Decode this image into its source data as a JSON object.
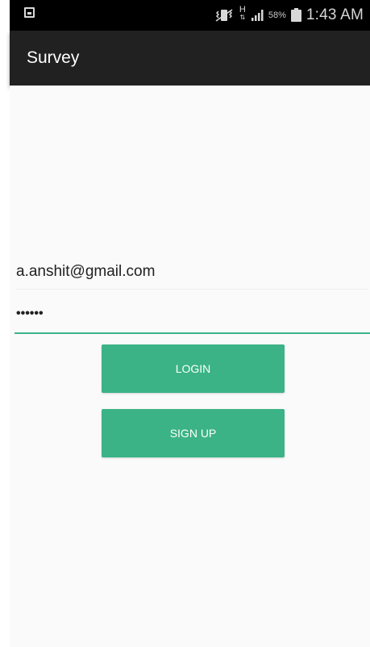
{
  "status_bar": {
    "net_type": "H",
    "battery_percent": "58%",
    "time": "1:43 AM"
  },
  "app_bar": {
    "title": "Survey"
  },
  "login_form": {
    "email_value": "a.anshit@gmail.com",
    "password_value": "••••••",
    "login_label": "LOGIN",
    "signup_label": "SIGN UP"
  },
  "colors": {
    "accent": "#3bb386",
    "app_bar": "#212121",
    "status_bar": "#000000",
    "background": "#fafafa"
  },
  "icons": {
    "status_left": "gallery-icon",
    "vibrate": "vibrate-icon",
    "signal": "signal-icon",
    "battery": "battery-icon"
  }
}
